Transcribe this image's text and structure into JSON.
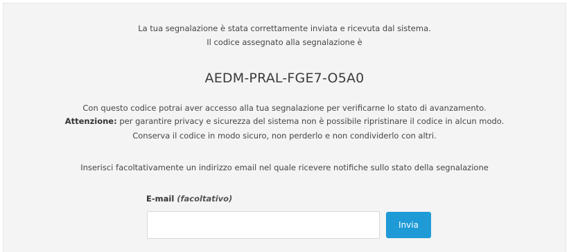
{
  "confirmation": {
    "line1": "La tua segnalazione è stata correttamente inviata e ricevuta dal sistema.",
    "line2": "Il codice assegnato alla segnalazione è",
    "code": "AEDM-PRAL-FGE7-O5A0"
  },
  "info": {
    "line1": "Con questo codice potrai aver accesso alla tua segnalazione per verificarne lo stato di avanzamento.",
    "warning_label": "Attenzione:",
    "warning_text": " per garantire privacy e sicurezza del sistema non è possibile ripristinare il codice in alcun modo.",
    "line3": "Conserva il codice in modo sicuro, non perderlo e non condividerlo con altri."
  },
  "email": {
    "prompt": "Inserisci facoltativamente un indirizzo email nel quale ricevere notifiche sullo stato della segnalazione",
    "label": "E-mail",
    "label_optional": "(facoltativo)",
    "value": "",
    "placeholder": "",
    "submit_label": "Invia"
  },
  "colors": {
    "panel_background": "#f4f4f4",
    "button": "#1e9ad6"
  }
}
